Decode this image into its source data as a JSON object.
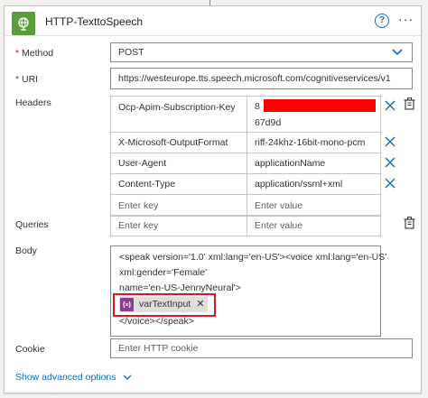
{
  "action": {
    "title": "HTTP-TexttoSpeech",
    "icon": "globe-icon",
    "brand_color": "#5a9e3a"
  },
  "method": {
    "required_mark": "*",
    "label": "Method",
    "value": "POST"
  },
  "uri": {
    "required_mark": "*",
    "label": "URI",
    "value": "https://westeurope.tts.speech.microsoft.com/cognitiveservices/v1"
  },
  "headers": {
    "label": "Headers",
    "rows": [
      {
        "key": "Ocp-Apim-Subscription-Key",
        "value": "8",
        "value_line2": "67d9d"
      },
      {
        "key": "X-Microsoft-OutputFormat",
        "value": "riff-24khz-16bit-mono-pcm"
      },
      {
        "key": "User-Agent",
        "value": "applicationName"
      },
      {
        "key": "Content-Type",
        "value": "application/ssml+xml"
      }
    ],
    "key_placeholder": "Enter key",
    "value_placeholder": "Enter value"
  },
  "queries": {
    "label": "Queries",
    "key_placeholder": "Enter key",
    "value_placeholder": "Enter value"
  },
  "body": {
    "label": "Body",
    "line1": "<speak version='1.0' xml:lang='en-US'><voice xml:lang='en-US'",
    "line2": "xml:gender='Female'",
    "line3": "name='en-US-JennyNeural'>",
    "token_label": "varTextInput",
    "token_icon": "variable-icon",
    "token_color": "#8d3d8e",
    "line4": "</voice></speak>"
  },
  "cookie": {
    "label": "Cookie",
    "placeholder": "Enter HTTP cookie"
  },
  "advanced_link": "Show advanced options",
  "accent_color": "#0f6cbd",
  "highlight_color": "#e81123"
}
